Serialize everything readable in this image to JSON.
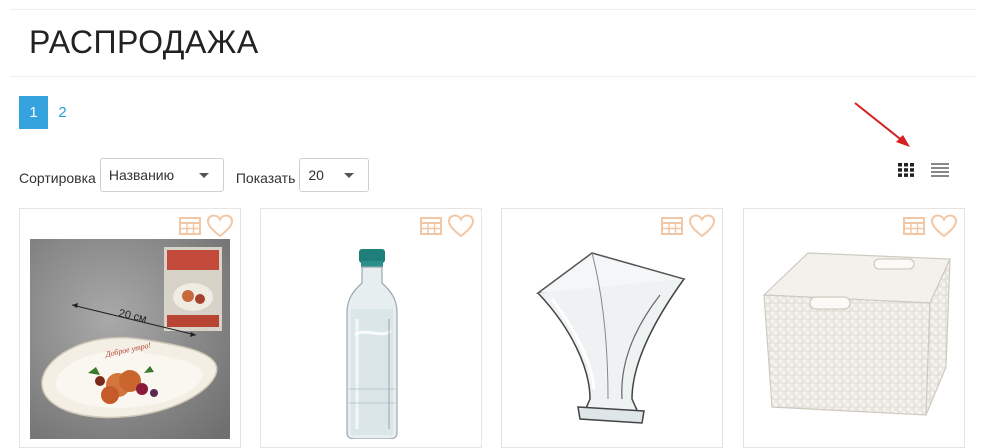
{
  "page": {
    "title": "РАСПРОДАЖА"
  },
  "pagination": {
    "pages": [
      "1",
      "2"
    ],
    "current": "1"
  },
  "sort": {
    "label": "Сортировка",
    "value": "Названию"
  },
  "show": {
    "label": "Показать",
    "value": "20"
  },
  "view": {
    "modes": [
      "grid",
      "list"
    ],
    "active": "grid"
  },
  "products": [
    {
      "image_icon": "plate-box-photo",
      "image_text": "20 см"
    },
    {
      "image_icon": "glass-bottle-photo"
    },
    {
      "image_icon": "glass-vase-photo"
    },
    {
      "image_icon": "plastic-basket-photo"
    }
  ],
  "colors": {
    "accent": "#35a3dd",
    "card_icon": "#f2c7a6",
    "arrow": "#d62020"
  }
}
